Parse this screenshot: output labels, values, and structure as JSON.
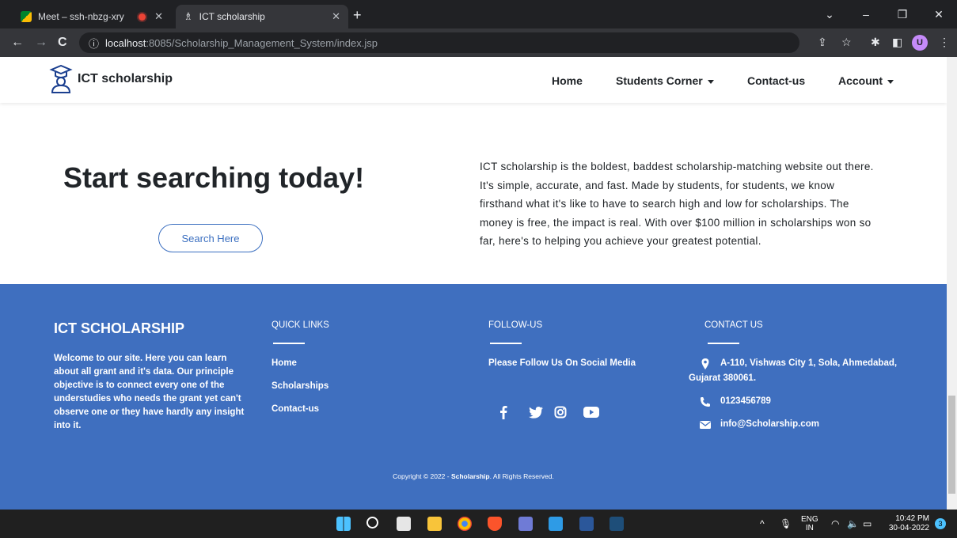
{
  "browser": {
    "tabs": [
      {
        "title": "Meet – ssh-nbzg-xry",
        "active": false
      },
      {
        "title": "ICT scholarship",
        "active": true
      }
    ],
    "new_tab_label": "+",
    "url_host": "localhost",
    "url_path": ":8085/Scholarship_Management_System/index.jsp"
  },
  "site": {
    "brand": "ICT scholarship",
    "nav": [
      {
        "label": "Home"
      },
      {
        "label": "Students Corner",
        "dropdown": true
      },
      {
        "label": "Contact-us"
      },
      {
        "label": "Account",
        "dropdown": true
      }
    ]
  },
  "hero": {
    "title": "Start searching today!",
    "button": "Search Here",
    "description": "ICT scholarship is the boldest, baddest scholarship-matching website out there. It's simple, accurate, and fast. Made by students, for students, we know firsthand what it's like to have to search high and low for scholarships. The money is free, the impact is real. With over $100 million in scholarships won so far, here's to helping you achieve your greatest potential."
  },
  "footer": {
    "title": "ICT SCHOLARSHIP",
    "about": "Welcome to our site. Here you can learn about all grant and it's data. Our principle objective is to connect every one of the understudies who needs the grant yet can't observe one or they have hardly any insight into it.",
    "quick_links_heading": "QUICK LINKS",
    "quick_links": [
      "Home",
      "Scholarships",
      "Contact-us"
    ],
    "follow_heading": "FOLLOW-US",
    "follow_text": "Please Follow Us On Social Media",
    "social_icons": [
      "facebook-icon",
      "twitter-icon",
      "instagram-icon",
      "youtube-icon"
    ],
    "contact_heading": "CONTACT US",
    "address_line1": "A-110, Vishwas City 1, Sola, Ahmedabad,",
    "address_line2": "Gujarat 380061.",
    "phone": "0123456789",
    "email": "info@Scholarship.com",
    "copyright_prefix": "Copyright © 2022 - ",
    "copyright_brand": "Scholarship",
    "copyright_suffix": ". All Rights Reserved."
  },
  "taskbar": {
    "language_line1": "ENG",
    "language_line2": "IN",
    "time": "10:42 PM",
    "date": "30-04-2022",
    "notifications": "3"
  },
  "colors": {
    "footer_bg": "#3f6fbf",
    "accent": "#3b6fc0"
  }
}
